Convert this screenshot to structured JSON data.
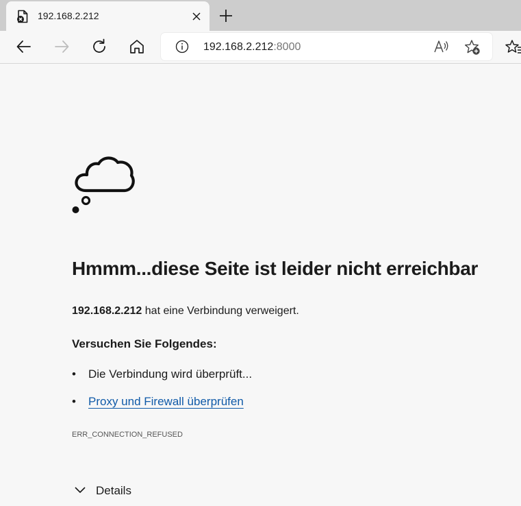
{
  "tab": {
    "title": "192.168.2.212"
  },
  "address": {
    "host": "192.168.2.212",
    "port": ":8000"
  },
  "icons": {
    "favicon": "page-error-icon",
    "close": "close-icon",
    "new_tab": "plus-icon",
    "back": "back-arrow-icon",
    "forward": "forward-arrow-icon",
    "reload": "reload-icon",
    "home": "home-icon",
    "info": "info-icon",
    "read_aloud": "read-aloud-icon",
    "add_favorite": "add-favorite-icon",
    "favorites": "favorites-icon",
    "illustration": "thought-cloud-icon",
    "details": "chevron-down-icon"
  },
  "error": {
    "headline": "Hmmm...diese Seite ist leider nicht erreichbar",
    "host": "192.168.2.212",
    "message": " hat eine Verbindung verweigert.",
    "try_heading": "Versuchen Sie Folgendes:",
    "suggestions": [
      {
        "bullet": "•",
        "text": "Die Verbindung wird überprüft..."
      },
      {
        "bullet": "•",
        "text": "Proxy und Firewall überprüfen"
      }
    ],
    "code": "ERR_CONNECTION_REFUSED",
    "details_label": "Details"
  },
  "colors": {
    "page_bg": "#f7f7f7",
    "tabstrip_bg": "#cdcdcd",
    "link": "#0f5aa8",
    "port_text": "#767676"
  }
}
